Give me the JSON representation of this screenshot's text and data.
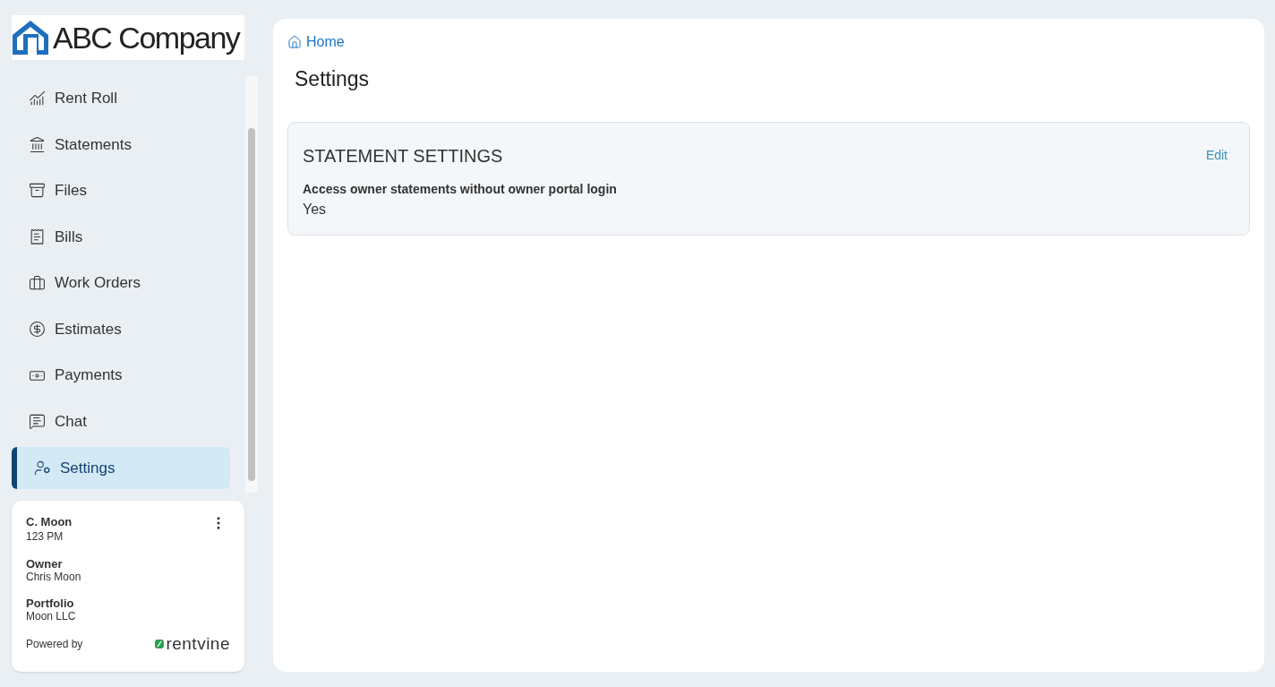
{
  "logo": {
    "text": "ABC Company"
  },
  "sidebar": {
    "items": [
      {
        "label": "Rent Roll",
        "selected": false
      },
      {
        "label": "Statements",
        "selected": false
      },
      {
        "label": "Files",
        "selected": false
      },
      {
        "label": "Bills",
        "selected": false
      },
      {
        "label": "Work Orders",
        "selected": false
      },
      {
        "label": "Estimates",
        "selected": false
      },
      {
        "label": "Payments",
        "selected": false
      },
      {
        "label": "Chat",
        "selected": false
      },
      {
        "label": "Settings",
        "selected": true
      }
    ]
  },
  "user_card": {
    "name": "C. Moon",
    "unit": "123 PM",
    "fields": [
      {
        "label": "Owner",
        "value": "Chris Moon"
      },
      {
        "label": "Portfolio",
        "value": "Moon LLC"
      }
    ],
    "powered_by": "Powered by",
    "brand": "rentvine"
  },
  "breadcrumb": "Home",
  "page_title": "Settings",
  "section": {
    "title": "STATEMENT SETTINGS",
    "edit": "Edit",
    "fields": [
      {
        "label": "Access owner statements without owner portal login",
        "value": "Yes"
      }
    ]
  }
}
